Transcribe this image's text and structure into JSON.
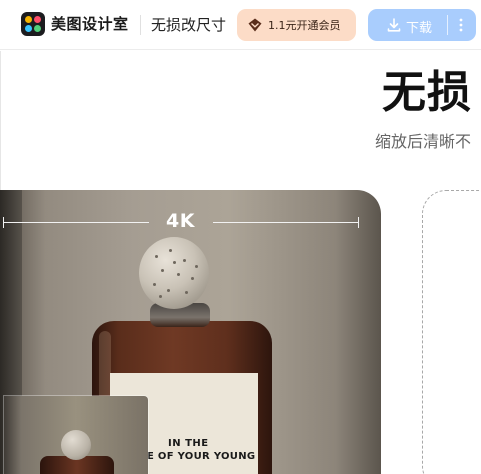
{
  "header": {
    "brand_name": "美图设计室",
    "page_name": "无损改尺寸",
    "vip_button_label": "1.1元开通会员",
    "download_button_label": "下载",
    "logo_colors": [
      "#f7b500",
      "#ff4d6a",
      "#39c6ff",
      "#52d07a"
    ]
  },
  "hero": {
    "title": "无损",
    "subtitle": "缩放后清晰不"
  },
  "showcase": {
    "resolution_label": "4K",
    "product_label_line1": "IN THE",
    "product_label_line2": "E  OF YOUR YOUNG"
  },
  "colors": {
    "vip_bg": "#fcdcc7",
    "download_bg": "#a9cdfd",
    "text_primary": "#111111",
    "text_secondary": "#666666"
  },
  "icons": [
    "brand-logo-icon",
    "diamond-icon",
    "download-icon",
    "more-vertical-icon"
  ]
}
